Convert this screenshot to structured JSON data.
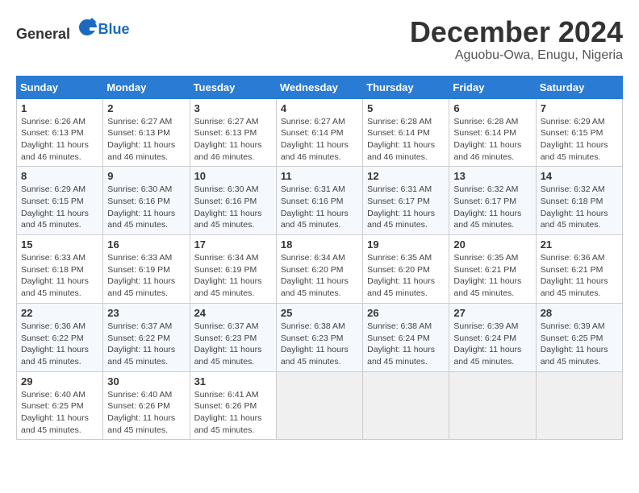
{
  "header": {
    "logo_general": "General",
    "logo_blue": "Blue",
    "month_title": "December 2024",
    "location": "Aguobu-Owa, Enugu, Nigeria"
  },
  "days_of_week": [
    "Sunday",
    "Monday",
    "Tuesday",
    "Wednesday",
    "Thursday",
    "Friday",
    "Saturday"
  ],
  "weeks": [
    [
      {
        "day": "1",
        "sunrise": "6:26 AM",
        "sunset": "6:13 PM",
        "daylight": "11 hours and 46 minutes."
      },
      {
        "day": "2",
        "sunrise": "6:27 AM",
        "sunset": "6:13 PM",
        "daylight": "11 hours and 46 minutes."
      },
      {
        "day": "3",
        "sunrise": "6:27 AM",
        "sunset": "6:13 PM",
        "daylight": "11 hours and 46 minutes."
      },
      {
        "day": "4",
        "sunrise": "6:27 AM",
        "sunset": "6:14 PM",
        "daylight": "11 hours and 46 minutes."
      },
      {
        "day": "5",
        "sunrise": "6:28 AM",
        "sunset": "6:14 PM",
        "daylight": "11 hours and 46 minutes."
      },
      {
        "day": "6",
        "sunrise": "6:28 AM",
        "sunset": "6:14 PM",
        "daylight": "11 hours and 46 minutes."
      },
      {
        "day": "7",
        "sunrise": "6:29 AM",
        "sunset": "6:15 PM",
        "daylight": "11 hours and 45 minutes."
      }
    ],
    [
      {
        "day": "8",
        "sunrise": "6:29 AM",
        "sunset": "6:15 PM",
        "daylight": "11 hours and 45 minutes."
      },
      {
        "day": "9",
        "sunrise": "6:30 AM",
        "sunset": "6:16 PM",
        "daylight": "11 hours and 45 minutes."
      },
      {
        "day": "10",
        "sunrise": "6:30 AM",
        "sunset": "6:16 PM",
        "daylight": "11 hours and 45 minutes."
      },
      {
        "day": "11",
        "sunrise": "6:31 AM",
        "sunset": "6:16 PM",
        "daylight": "11 hours and 45 minutes."
      },
      {
        "day": "12",
        "sunrise": "6:31 AM",
        "sunset": "6:17 PM",
        "daylight": "11 hours and 45 minutes."
      },
      {
        "day": "13",
        "sunrise": "6:32 AM",
        "sunset": "6:17 PM",
        "daylight": "11 hours and 45 minutes."
      },
      {
        "day": "14",
        "sunrise": "6:32 AM",
        "sunset": "6:18 PM",
        "daylight": "11 hours and 45 minutes."
      }
    ],
    [
      {
        "day": "15",
        "sunrise": "6:33 AM",
        "sunset": "6:18 PM",
        "daylight": "11 hours and 45 minutes."
      },
      {
        "day": "16",
        "sunrise": "6:33 AM",
        "sunset": "6:19 PM",
        "daylight": "11 hours and 45 minutes."
      },
      {
        "day": "17",
        "sunrise": "6:34 AM",
        "sunset": "6:19 PM",
        "daylight": "11 hours and 45 minutes."
      },
      {
        "day": "18",
        "sunrise": "6:34 AM",
        "sunset": "6:20 PM",
        "daylight": "11 hours and 45 minutes."
      },
      {
        "day": "19",
        "sunrise": "6:35 AM",
        "sunset": "6:20 PM",
        "daylight": "11 hours and 45 minutes."
      },
      {
        "day": "20",
        "sunrise": "6:35 AM",
        "sunset": "6:21 PM",
        "daylight": "11 hours and 45 minutes."
      },
      {
        "day": "21",
        "sunrise": "6:36 AM",
        "sunset": "6:21 PM",
        "daylight": "11 hours and 45 minutes."
      }
    ],
    [
      {
        "day": "22",
        "sunrise": "6:36 AM",
        "sunset": "6:22 PM",
        "daylight": "11 hours and 45 minutes."
      },
      {
        "day": "23",
        "sunrise": "6:37 AM",
        "sunset": "6:22 PM",
        "daylight": "11 hours and 45 minutes."
      },
      {
        "day": "24",
        "sunrise": "6:37 AM",
        "sunset": "6:23 PM",
        "daylight": "11 hours and 45 minutes."
      },
      {
        "day": "25",
        "sunrise": "6:38 AM",
        "sunset": "6:23 PM",
        "daylight": "11 hours and 45 minutes."
      },
      {
        "day": "26",
        "sunrise": "6:38 AM",
        "sunset": "6:24 PM",
        "daylight": "11 hours and 45 minutes."
      },
      {
        "day": "27",
        "sunrise": "6:39 AM",
        "sunset": "6:24 PM",
        "daylight": "11 hours and 45 minutes."
      },
      {
        "day": "28",
        "sunrise": "6:39 AM",
        "sunset": "6:25 PM",
        "daylight": "11 hours and 45 minutes."
      }
    ],
    [
      {
        "day": "29",
        "sunrise": "6:40 AM",
        "sunset": "6:25 PM",
        "daylight": "11 hours and 45 minutes."
      },
      {
        "day": "30",
        "sunrise": "6:40 AM",
        "sunset": "6:26 PM",
        "daylight": "11 hours and 45 minutes."
      },
      {
        "day": "31",
        "sunrise": "6:41 AM",
        "sunset": "6:26 PM",
        "daylight": "11 hours and 45 minutes."
      },
      null,
      null,
      null,
      null
    ]
  ]
}
